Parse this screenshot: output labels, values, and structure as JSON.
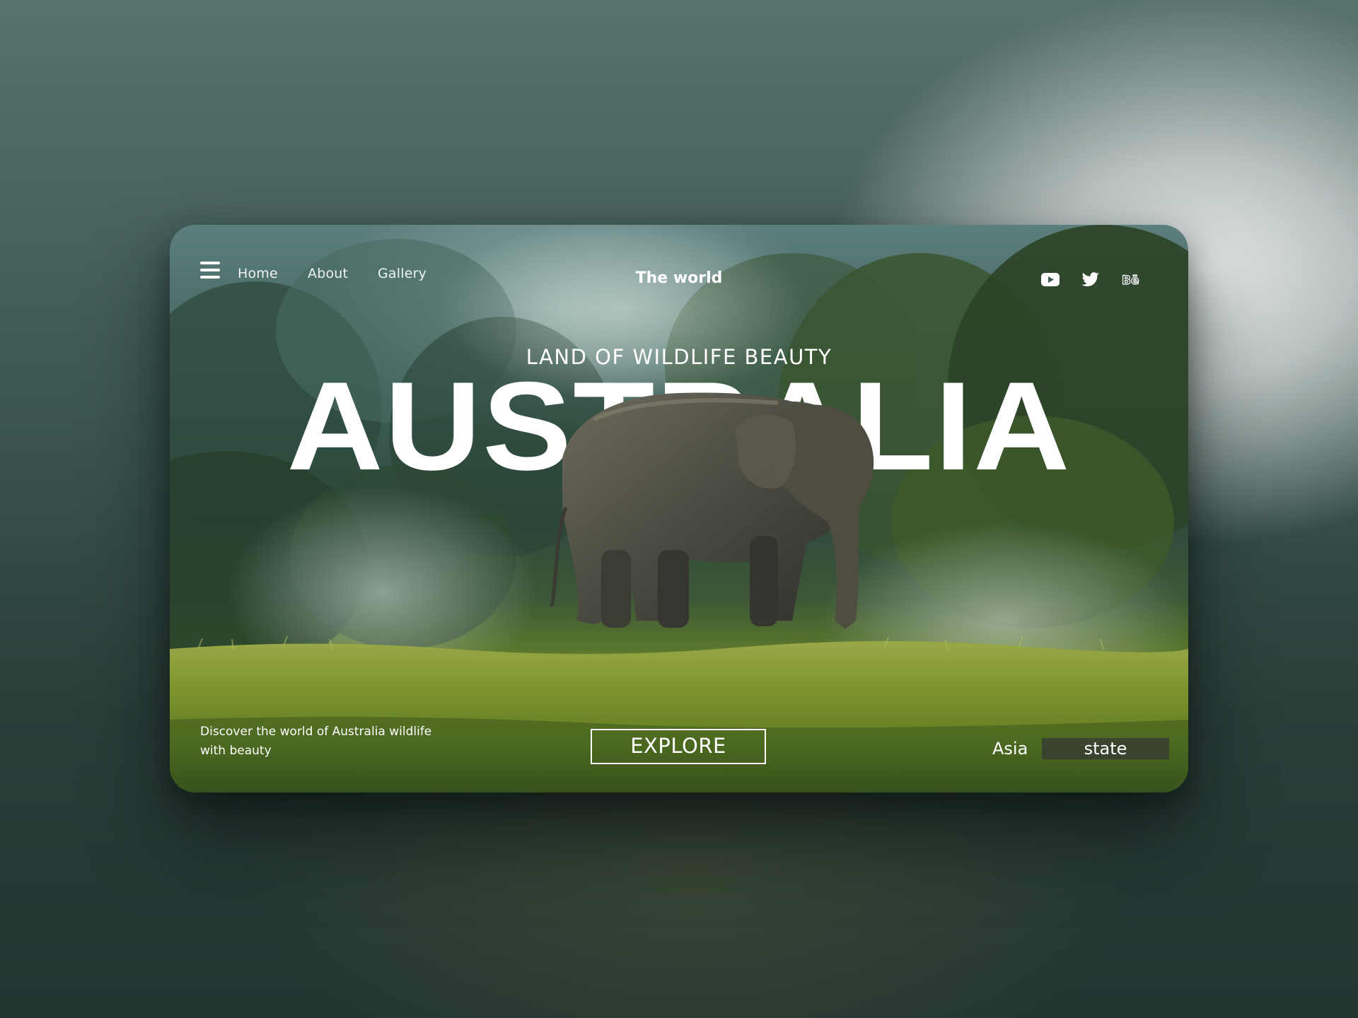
{
  "nav": {
    "menu_icon": "hamburger-icon",
    "links": [
      "Home",
      "About",
      "Gallery"
    ],
    "brand": "The world",
    "social": [
      "youtube-icon",
      "twitter-icon",
      "behance-icon"
    ]
  },
  "hero": {
    "tagline": "LAND OF WILDLIFE BEAUTY",
    "title": "AUSTRALIA"
  },
  "footer": {
    "description": "Discover the world of Australia wildlife with beauty",
    "cta": "EXPLORE",
    "region": "Asia",
    "chip": "state"
  },
  "colors": {
    "text": "#ffffff",
    "chip_bg": "#373c32"
  }
}
